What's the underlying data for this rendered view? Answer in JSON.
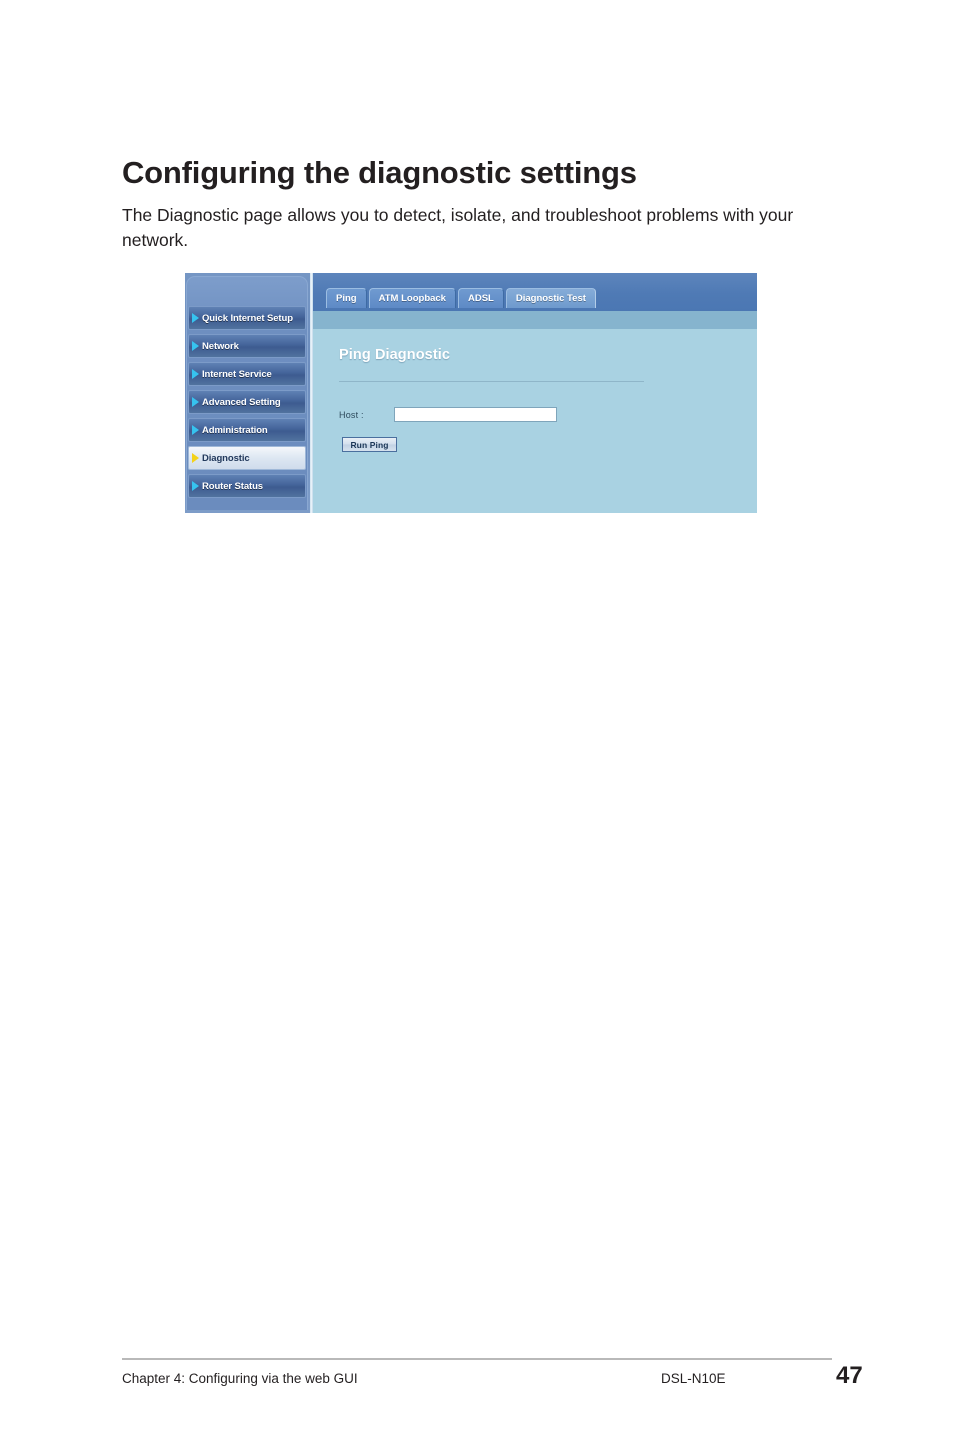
{
  "page": {
    "title": "Configuring the diagnostic settings",
    "intro": "The Diagnostic page allows you to detect, isolate, and troubleshoot problems with your network."
  },
  "router_ui": {
    "sidebar": {
      "items": [
        {
          "label": "Quick Internet Setup",
          "selected": false,
          "arrow_color": "#36c3ef"
        },
        {
          "label": "Network",
          "selected": false,
          "arrow_color": "#36c3ef"
        },
        {
          "label": "Internet Service",
          "selected": false,
          "arrow_color": "#36c3ef"
        },
        {
          "label": "Advanced Setting",
          "selected": false,
          "arrow_color": "#36c3ef"
        },
        {
          "label": "Administration",
          "selected": false,
          "arrow_color": "#36c3ef"
        },
        {
          "label": "Diagnostic",
          "selected": true,
          "arrow_color": "#f3d21a"
        },
        {
          "label": "Router Status",
          "selected": false,
          "arrow_color": "#36c3ef"
        }
      ]
    },
    "tabs": [
      {
        "label": "Ping",
        "active": false
      },
      {
        "label": "ATM Loopback",
        "active": false
      },
      {
        "label": "ADSL",
        "active": false
      },
      {
        "label": "Diagnostic Test",
        "active": true
      }
    ],
    "panel": {
      "heading": "Ping Diagnostic",
      "host_label": "Host :",
      "host_value": "",
      "host_placeholder": "",
      "run_button": "Run Ping"
    },
    "colors": {
      "header_blue": "#4f7ab5",
      "subbar_blue": "#86b4ce",
      "content_blue": "#a9d2e2",
      "sidebar_blue": "#6b8cbe",
      "accent_arrow": "#36c3ef",
      "selected_arrow": "#f3d21a"
    }
  },
  "footer": {
    "chapter": "Chapter 4: Configuring via the web GUI",
    "model": "DSL-N10E",
    "page_number": "47"
  }
}
